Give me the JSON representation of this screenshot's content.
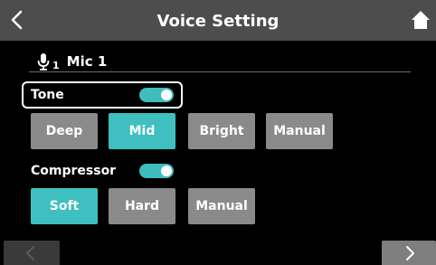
{
  "header": {
    "title": "Voice Setting",
    "back_icon": "chevron-left-icon",
    "home_icon": "home-icon"
  },
  "mic": {
    "icon": "microphone-icon",
    "number": "1",
    "name": "Mic 1"
  },
  "tone": {
    "label": "Tone",
    "enabled": true,
    "options": [
      "Deep",
      "Mid",
      "Bright",
      "Manual"
    ],
    "selected": "Mid"
  },
  "compressor": {
    "label": "Compressor",
    "enabled": true,
    "options": [
      "Soft",
      "Hard",
      "Manual"
    ],
    "selected": "Soft"
  },
  "nav": {
    "prev_icon": "chevron-left-icon",
    "next_icon": "chevron-right-icon"
  },
  "colors": {
    "accent": "#3fbfbf",
    "button": "#8a8a8a",
    "header": "#4d4d4d",
    "background": "#000000"
  }
}
